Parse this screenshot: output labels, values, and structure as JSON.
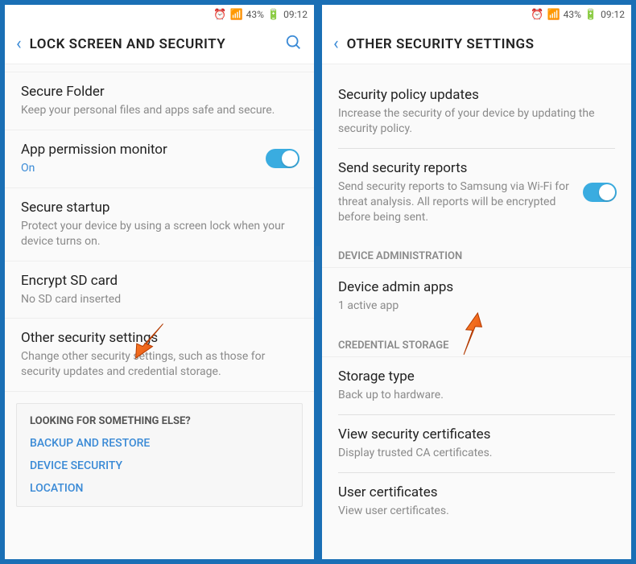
{
  "status": {
    "battery_pct": "43%",
    "time": "09:12"
  },
  "left": {
    "title": "LOCK SCREEN AND SECURITY",
    "items": {
      "secure_folder": {
        "title": "Secure Folder",
        "sub": "Keep your personal files and apps safe and secure."
      },
      "app_perm": {
        "title": "App permission monitor",
        "sub": "On"
      },
      "secure_startup": {
        "title": "Secure startup",
        "sub": "Protect your device by using a screen lock when your device turns on."
      },
      "encrypt_sd": {
        "title": "Encrypt SD card",
        "sub": "No SD card inserted"
      },
      "other_sec": {
        "title": "Other security settings",
        "sub": "Change other security settings, such as those for security updates and credential storage."
      }
    },
    "footer": {
      "head": "LOOKING FOR SOMETHING ELSE?",
      "links": {
        "backup": "BACKUP AND RESTORE",
        "devsec": "DEVICE SECURITY",
        "loc": "LOCATION"
      }
    }
  },
  "right": {
    "title": "OTHER SECURITY SETTINGS",
    "items": {
      "policy": {
        "title": "Security policy updates",
        "sub": "Increase the security of your device by updating the security policy."
      },
      "reports": {
        "title": "Send security reports",
        "sub": "Send security reports to Samsung via Wi-Fi for threat analysis. All reports will be encrypted before being sent."
      },
      "dev_admin_head": "DEVICE ADMINISTRATION",
      "admin_apps": {
        "title": "Device admin apps",
        "sub": "1 active app"
      },
      "cred_head": "CREDENTIAL STORAGE",
      "storage": {
        "title": "Storage type",
        "sub": "Back up to hardware."
      },
      "view_certs": {
        "title": "View security certificates",
        "sub": "Display trusted CA certificates."
      },
      "user_certs": {
        "title": "User certificates",
        "sub": "View user certificates."
      }
    }
  }
}
